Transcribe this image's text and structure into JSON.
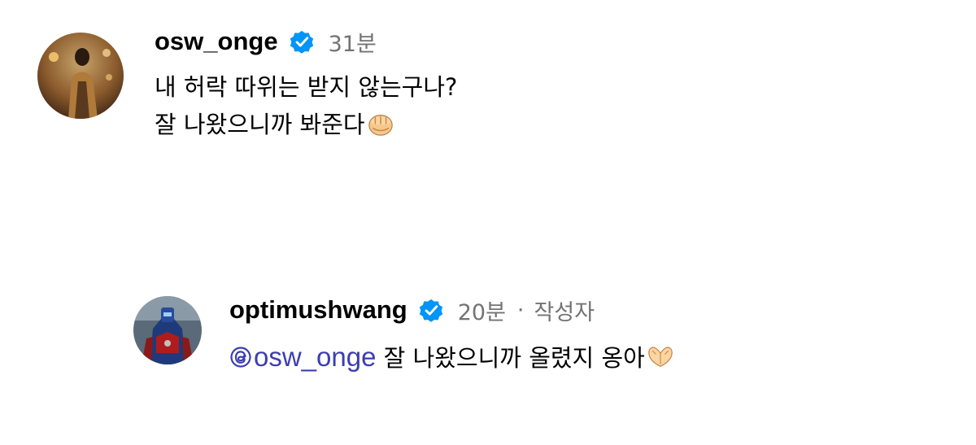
{
  "comments": [
    {
      "username": "osw_onge",
      "verified": true,
      "timestamp": "31분",
      "lines": [
        "내 허락 따위는 받지 않는구나?",
        "잘 나왔으니까 봐준다"
      ],
      "emoji": "fist-emoji"
    },
    {
      "username": "optimushwang",
      "verified": true,
      "timestamp": "20분",
      "separator": "·",
      "author_label": "작성자",
      "mention": "osw_onge",
      "text": " 잘 나왔으니까 올렸지 옹아",
      "emoji": "heart-hands-emoji"
    }
  ],
  "colors": {
    "verified_badge": "#0095f6",
    "mention": "#3b3eb0",
    "secondary_text": "#737373"
  }
}
